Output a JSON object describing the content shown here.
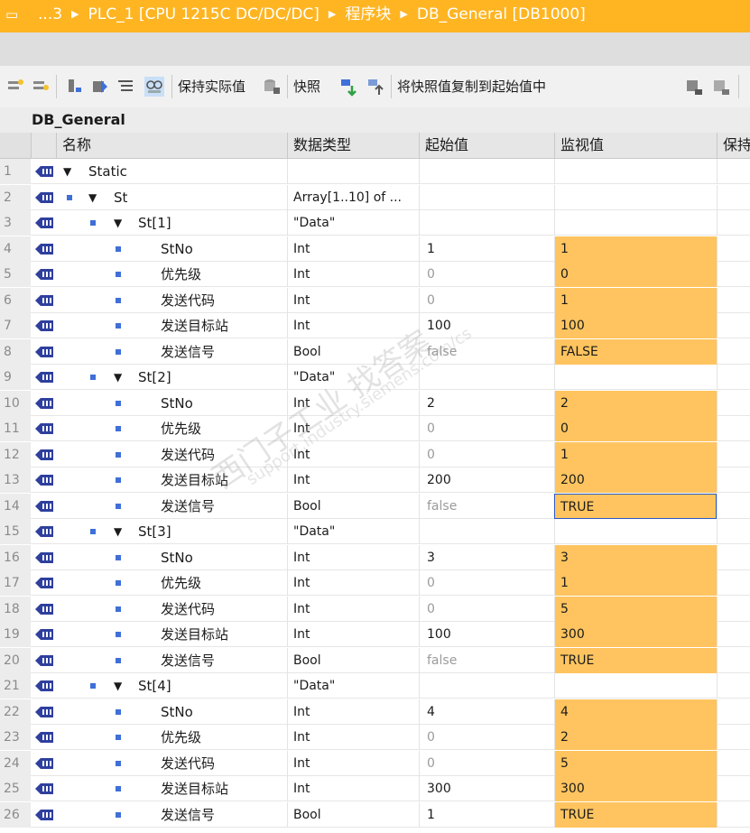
{
  "breadcrumb": {
    "items": [
      "...3",
      "PLC_1 [CPU 1215C DC/DC/DC]",
      "程序块",
      "DB_General [DB1000]"
    ]
  },
  "toolbar": {
    "keep_actual_label": "保持实际值",
    "snapshot_label": "快照",
    "copy_snapshot_label": "将快照值复制到起始值中"
  },
  "db_name": "DB_General",
  "columns": {
    "name": "名称",
    "datatype": "数据类型",
    "start": "起始值",
    "monitor": "监视值",
    "retain": "保持"
  },
  "colors": {
    "accent": "#ffb522",
    "monitor_bg": "#ffc45f",
    "indicator": "#3f6fd8",
    "selection": "#2b58c4"
  },
  "rows": [
    {
      "n": "1",
      "level": 0,
      "expand": true,
      "name": "Static",
      "type": "",
      "start": "",
      "start_gray": false,
      "monitor": "",
      "active": false
    },
    {
      "n": "2",
      "level": 1,
      "expand": true,
      "name": "St",
      "type": "Array[1..10] of ...",
      "start": "",
      "start_gray": false,
      "monitor": "",
      "active": false
    },
    {
      "n": "3",
      "level": 2,
      "expand": true,
      "name": "St[1]",
      "type": "\"Data\"",
      "start": "",
      "start_gray": false,
      "monitor": "",
      "active": false
    },
    {
      "n": "4",
      "level": 3,
      "expand": false,
      "name": "StNo",
      "type": "Int",
      "start": "1",
      "start_gray": false,
      "monitor": "1",
      "active": true
    },
    {
      "n": "5",
      "level": 3,
      "expand": false,
      "name": "优先级",
      "type": "Int",
      "start": "0",
      "start_gray": true,
      "monitor": "0",
      "active": true
    },
    {
      "n": "6",
      "level": 3,
      "expand": false,
      "name": "发送代码",
      "type": "Int",
      "start": "0",
      "start_gray": true,
      "monitor": "1",
      "active": true
    },
    {
      "n": "7",
      "level": 3,
      "expand": false,
      "name": "发送目标站",
      "type": "Int",
      "start": "100",
      "start_gray": false,
      "monitor": "100",
      "active": true
    },
    {
      "n": "8",
      "level": 3,
      "expand": false,
      "name": "发送信号",
      "type": "Bool",
      "start": "false",
      "start_gray": true,
      "monitor": "FALSE",
      "active": true
    },
    {
      "n": "9",
      "level": 2,
      "expand": true,
      "name": "St[2]",
      "type": "\"Data\"",
      "start": "",
      "start_gray": false,
      "monitor": "",
      "active": false
    },
    {
      "n": "10",
      "level": 3,
      "expand": false,
      "name": "StNo",
      "type": "Int",
      "start": "2",
      "start_gray": false,
      "monitor": "2",
      "active": true
    },
    {
      "n": "11",
      "level": 3,
      "expand": false,
      "name": "优先级",
      "type": "Int",
      "start": "0",
      "start_gray": true,
      "monitor": "0",
      "active": true
    },
    {
      "n": "12",
      "level": 3,
      "expand": false,
      "name": "发送代码",
      "type": "Int",
      "start": "0",
      "start_gray": true,
      "monitor": "1",
      "active": true
    },
    {
      "n": "13",
      "level": 3,
      "expand": false,
      "name": "发送目标站",
      "type": "Int",
      "start": "200",
      "start_gray": false,
      "monitor": "200",
      "active": true
    },
    {
      "n": "14",
      "level": 3,
      "expand": false,
      "name": "发送信号",
      "type": "Bool",
      "start": "false",
      "start_gray": true,
      "monitor": "TRUE",
      "active": true,
      "selected": true
    },
    {
      "n": "15",
      "level": 2,
      "expand": true,
      "name": "St[3]",
      "type": "\"Data\"",
      "start": "",
      "start_gray": false,
      "monitor": "",
      "active": false
    },
    {
      "n": "16",
      "level": 3,
      "expand": false,
      "name": "StNo",
      "type": "Int",
      "start": "3",
      "start_gray": false,
      "monitor": "3",
      "active": true
    },
    {
      "n": "17",
      "level": 3,
      "expand": false,
      "name": "优先级",
      "type": "Int",
      "start": "0",
      "start_gray": true,
      "monitor": "1",
      "active": true
    },
    {
      "n": "18",
      "level": 3,
      "expand": false,
      "name": "发送代码",
      "type": "Int",
      "start": "0",
      "start_gray": true,
      "monitor": "5",
      "active": true
    },
    {
      "n": "19",
      "level": 3,
      "expand": false,
      "name": "发送目标站",
      "type": "Int",
      "start": "100",
      "start_gray": false,
      "monitor": "300",
      "active": true
    },
    {
      "n": "20",
      "level": 3,
      "expand": false,
      "name": "发送信号",
      "type": "Bool",
      "start": "false",
      "start_gray": true,
      "monitor": "TRUE",
      "active": true
    },
    {
      "n": "21",
      "level": 2,
      "expand": true,
      "name": "St[4]",
      "type": "\"Data\"",
      "start": "",
      "start_gray": false,
      "monitor": "",
      "active": false
    },
    {
      "n": "22",
      "level": 3,
      "expand": false,
      "name": "StNo",
      "type": "Int",
      "start": "4",
      "start_gray": false,
      "monitor": "4",
      "active": true
    },
    {
      "n": "23",
      "level": 3,
      "expand": false,
      "name": "优先级",
      "type": "Int",
      "start": "0",
      "start_gray": true,
      "monitor": "2",
      "active": true
    },
    {
      "n": "24",
      "level": 3,
      "expand": false,
      "name": "发送代码",
      "type": "Int",
      "start": "0",
      "start_gray": true,
      "monitor": "5",
      "active": true
    },
    {
      "n": "25",
      "level": 3,
      "expand": false,
      "name": "发送目标站",
      "type": "Int",
      "start": "300",
      "start_gray": false,
      "monitor": "300",
      "active": true
    },
    {
      "n": "26",
      "level": 3,
      "expand": false,
      "name": "发送信号",
      "type": "Bool",
      "start": "1",
      "start_gray": false,
      "monitor": "TRUE",
      "active": true
    }
  ],
  "watermark": {
    "text": "西门子工业 找答案",
    "url": "support.industry.siemens.com/cs"
  }
}
